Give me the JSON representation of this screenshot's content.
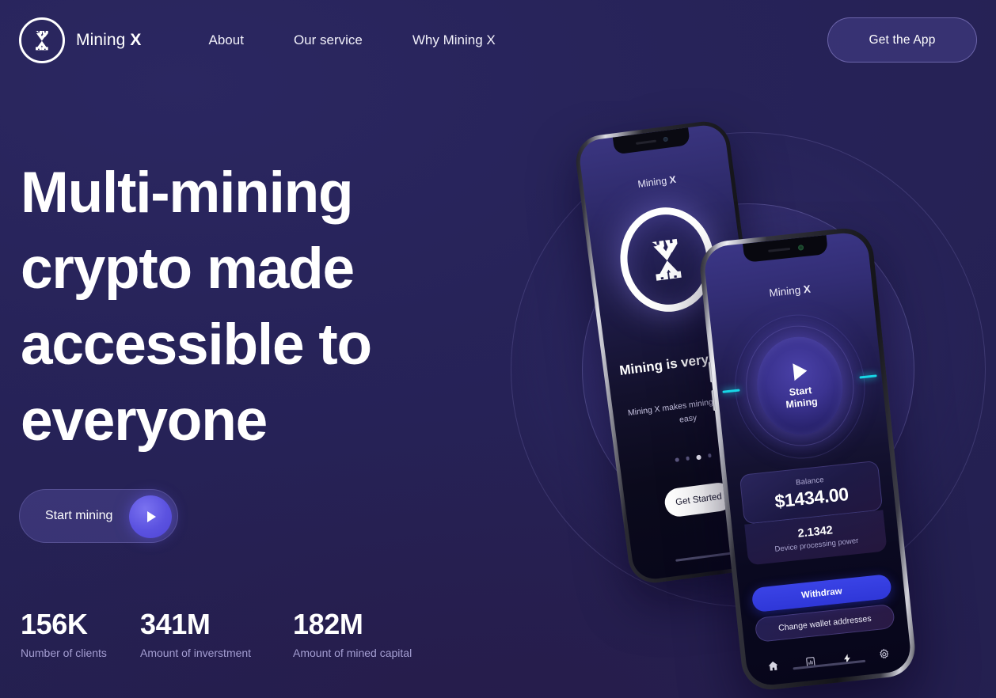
{
  "nav": {
    "brand": {
      "name_light": "Mining ",
      "name_bold": "X",
      "logo_icon": "mining-x-logo-icon"
    },
    "links": [
      {
        "label": "About"
      },
      {
        "label": "Our service"
      },
      {
        "label": "Why Mining X"
      }
    ],
    "cta": {
      "label": "Get the App"
    }
  },
  "hero": {
    "headline": "Multi-mining crypto made accessible to everyone",
    "start_button": {
      "label": "Start mining",
      "icon": "play-icon"
    }
  },
  "stats": [
    {
      "value": "156K",
      "label": "Number of clients"
    },
    {
      "value": "341M",
      "label": "Amount of inverstment"
    },
    {
      "value": "182M",
      "label": "Amount of mined capital"
    }
  ],
  "phone_back": {
    "app_title_light": "Mining ",
    "app_title_bold": "X",
    "logo_icon": "mining-x-logo-icon",
    "heading": "Mining is very easy",
    "subtext": "Mining X makes mining fast and easy",
    "pagination": {
      "total": 4,
      "active_index": 2
    },
    "cta": {
      "label": "Get Started"
    }
  },
  "phone_front": {
    "app_title_light": "Mining ",
    "app_title_bold": "X",
    "start_mining": {
      "label": "Start\nMining",
      "line1": "Start",
      "line2": "Mining",
      "icon": "play-icon"
    },
    "balance": {
      "label": "Balance",
      "value": "$1434.00"
    },
    "power": {
      "value": "2.1342",
      "label": "Device processing power"
    },
    "withdraw_button": {
      "label": "Withdraw"
    },
    "wallet_button": {
      "label": "Change wallet addresses"
    },
    "tabbar": [
      {
        "icon": "home-icon",
        "active": true
      },
      {
        "icon": "chart-icon",
        "active": false
      },
      {
        "icon": "bolt-icon",
        "active": false
      },
      {
        "icon": "gear-icon",
        "active": false
      }
    ]
  },
  "colors": {
    "background": "#262256",
    "accent_blue": "#3a43e6",
    "accent_purple": "#5b52e0",
    "accent_cyan": "#17d7e6",
    "text_muted": "#a49ed2"
  }
}
